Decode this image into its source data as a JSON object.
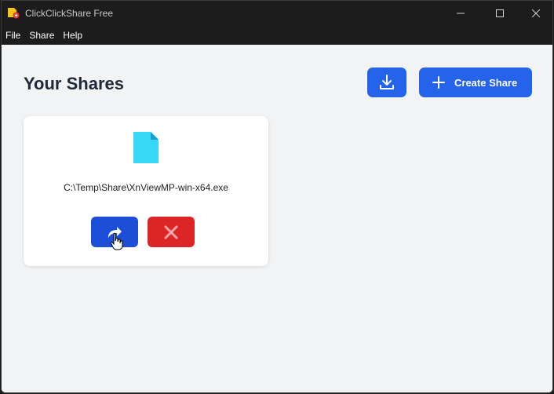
{
  "window": {
    "title": "ClickClickShare Free"
  },
  "menu": {
    "items": [
      "File",
      "Share",
      "Help"
    ]
  },
  "main": {
    "heading": "Your Shares",
    "create_label": "Create Share"
  },
  "shares": [
    {
      "path": "C:\\Temp\\Share\\XnViewMP-win-x64.exe"
    }
  ],
  "colors": {
    "accent": "#2563eb",
    "share_button": "#1d4ed8",
    "delete_button": "#dc2626",
    "file_icon": "#38d8f8"
  },
  "icons": {
    "import": "download-icon",
    "create": "plus-icon",
    "share": "share-arrow-icon",
    "delete": "close-icon",
    "file": "file-icon"
  }
}
